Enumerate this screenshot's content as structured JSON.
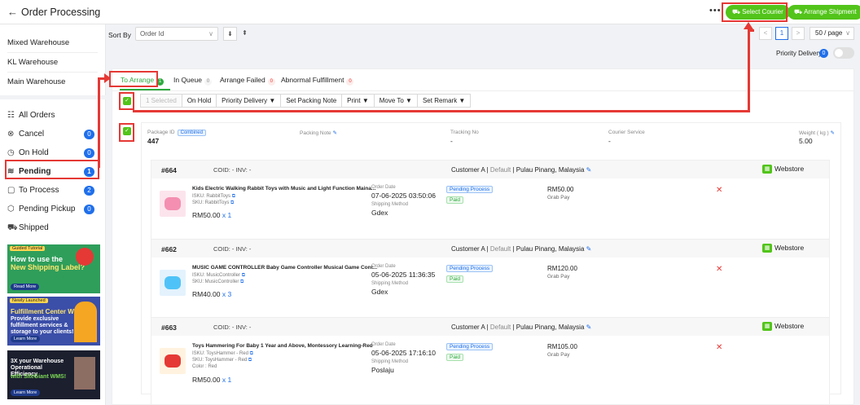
{
  "header": {
    "title": "Order Processing",
    "more_label": "•••",
    "select_courier": "Select Courier",
    "arrange_shipment": "Arrange Shipment"
  },
  "sidebar": {
    "warehouses": [
      "Mixed Warehouse",
      "KL Warehouse",
      "Main Warehouse"
    ],
    "nav": [
      {
        "label": "All Orders",
        "icon": "inbox-icon",
        "glyph": "☷",
        "count": ""
      },
      {
        "label": "Cancel",
        "icon": "cancel-icon",
        "glyph": "⊗",
        "count": "0"
      },
      {
        "label": "On Hold",
        "icon": "pause-icon",
        "glyph": "◷",
        "count": "0"
      },
      {
        "label": "Pending",
        "icon": "layers-icon",
        "glyph": "≋",
        "count": "1"
      },
      {
        "label": "To Process",
        "icon": "clipboard-icon",
        "glyph": "▢",
        "count": "2"
      },
      {
        "label": "Pending Pickup",
        "icon": "package-icon",
        "glyph": "⬡",
        "count": "0"
      },
      {
        "label": "Shipped",
        "icon": "truck-icon",
        "glyph": "⛟",
        "count": ""
      }
    ],
    "banners": [
      {
        "tag": "Guided Tutorial",
        "text1": "How to use the",
        "text2": "New Shipping Label?",
        "cta": "Read More"
      },
      {
        "tag": "Newly Launched",
        "text1": "Fulfillment Center WMS",
        "text2": "Provide exclusive fulfillment services & storage to your clients!",
        "cta": "Learn More"
      },
      {
        "tag": "",
        "text1": "3X your Warehouse Operational Efficiency",
        "text2": "with SiteGiant WMS!",
        "cta": "Learn More"
      }
    ]
  },
  "sort": {
    "label": "Sort By",
    "value": "Order Id"
  },
  "pager": {
    "prev": "<",
    "page": "1",
    "next": ">",
    "per_page": "50 / page"
  },
  "priority": {
    "label": "Priority Delivery",
    "count": "0"
  },
  "tabs": [
    {
      "label": "To Arrange",
      "count": "1"
    },
    {
      "label": "In Queue",
      "count": "0"
    },
    {
      "label": "Arrange Failed",
      "count": "0"
    },
    {
      "label": "Abnormal Fulfillment",
      "count": "0"
    }
  ],
  "actions": [
    "1 Selected",
    "On Hold",
    "Priority Delivery ▼",
    "Set Packing Note",
    "Print ▼",
    "Move To ▼",
    "Set Remark ▼"
  ],
  "package": {
    "id_label": "Package ID",
    "badge": "Combined",
    "id": "447",
    "note_label": "Packing Note",
    "tracking_label": "Tracking No",
    "tracking": "-",
    "courier_label": "Courier Service",
    "courier": "-",
    "weight_label": "Weight ( kg )",
    "weight": "5.00"
  },
  "orders": [
    {
      "id": "#664",
      "co": "COID: -    INV: -",
      "customer": "Customer A",
      "default": "Default",
      "location": "Pulau Pinang, Malaysia",
      "store": "Webstore",
      "product": "Kids Electric Walking Rabbit Toys with Music and Light Function Mainа...",
      "isku": "ISKU: RabbitToys",
      "sku": "SKU: RabbitToys",
      "color": "",
      "price": "RM50.00",
      "qty": "x 1",
      "date_label": "Order Date",
      "date": "07-06-2025 03:50:06",
      "ship_label": "Shipping Method",
      "ship": "Gdex",
      "status": "Pending Process",
      "paid": "Paid",
      "amount": "RM50.00",
      "payment": "Grab Pay"
    },
    {
      "id": "#662",
      "co": "COID: -    INV: -",
      "customer": "Customer A",
      "default": "Default",
      "location": "Pulau Pinang, Malaysia",
      "store": "Webstore",
      "product": "MUSIC GAME CONTROLLER Baby Game Controller Musical Game Cont...",
      "isku": "ISKU: MusicController",
      "sku": "SKU: MusicController",
      "color": "",
      "price": "RM40.00",
      "qty": "x 3",
      "date_label": "Order Date",
      "date": "05-06-2025 11:36:35",
      "ship_label": "Shipping Method",
      "ship": "Gdex",
      "status": "Pending Process",
      "paid": "Paid",
      "amount": "RM120.00",
      "payment": "Grab Pay"
    },
    {
      "id": "#663",
      "co": "COID: -    INV: -",
      "customer": "Customer A",
      "default": "Default",
      "location": "Pulau Pinang, Malaysia",
      "store": "Webstore",
      "product": "Toys Hammering For Baby 1 Year and Above, Montessory Learning-Red",
      "isku": "ISKU: ToysHammer - Red",
      "sku": "SKU: ToysHammer - Red",
      "color": "Color : Red",
      "price": "RM50.00",
      "qty": "x 1",
      "date_label": "Order Date",
      "date": "05-06-2025 17:16:10",
      "ship_label": "Shipping Method",
      "ship": "Poslaju",
      "status": "Pending Process",
      "paid": "Paid",
      "amount": "RM105.00",
      "payment": "Grab Pay"
    }
  ],
  "colors": {
    "accent_green": "#52c41a",
    "annotation_red": "#e53935",
    "badge_blue": "#1f6feb"
  }
}
